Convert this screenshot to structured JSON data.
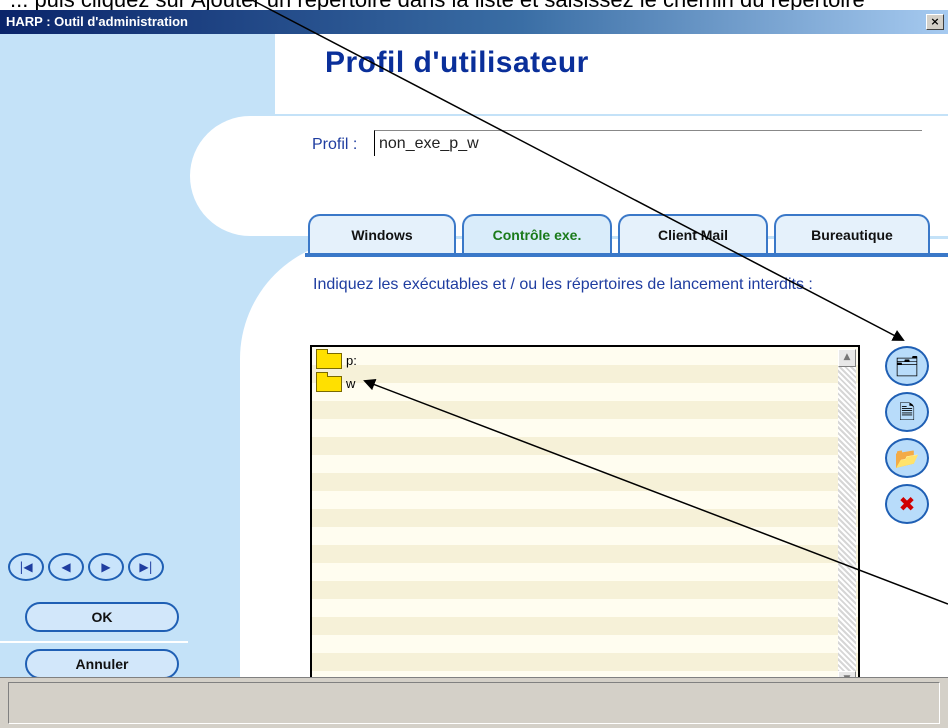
{
  "doc_text": "... puis cliquez sur Ajouter un répertoire dans la liste et saisissez le chemin du répertoire",
  "window": {
    "title": "HARP : Outil d'administration",
    "close_glyph": "×"
  },
  "page": {
    "title": "Profil d'utilisateur",
    "profil_label": "Profil :",
    "profil_value": "non_exe_p_w"
  },
  "tabs": [
    {
      "label": "Windows",
      "active": false
    },
    {
      "label": "Contrôle exe.",
      "active": true
    },
    {
      "label": "Client Mail",
      "active": false
    },
    {
      "label": "Bureautique",
      "active": false
    }
  ],
  "instructions": "Indiquez les exécutables et / ou les répertoires de lancement interdits :",
  "list": {
    "items": [
      {
        "icon": "folder-icon",
        "label": "p:"
      },
      {
        "icon": "folder-icon",
        "label": "w"
      }
    ]
  },
  "side_buttons": [
    {
      "icon": "add-folder-icon",
      "glyph": "🗂"
    },
    {
      "icon": "add-file-icon",
      "glyph": "🗎"
    },
    {
      "icon": "browse-folder-icon",
      "glyph": "📂"
    },
    {
      "icon": "delete-icon",
      "glyph": "✖"
    }
  ],
  "nav_buttons": [
    {
      "icon": "first-icon",
      "glyph": "|◀"
    },
    {
      "icon": "prev-icon",
      "glyph": "◀"
    },
    {
      "icon": "next-icon",
      "glyph": "▶"
    },
    {
      "icon": "last-icon",
      "glyph": "▶|"
    }
  ],
  "actions": {
    "ok_label": "OK",
    "cancel_label": "Annuler"
  },
  "colors": {
    "background": "#c4e2f8",
    "accent": "#1f5fb4",
    "title_blue": "#0a2f9a",
    "active_tab_text": "#1a7a1a"
  }
}
